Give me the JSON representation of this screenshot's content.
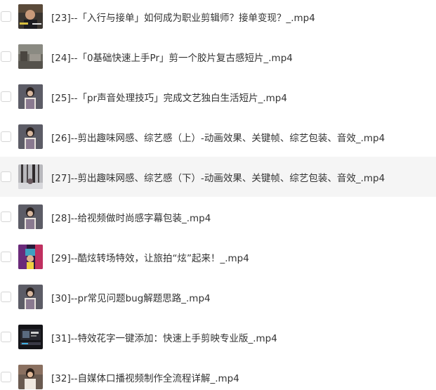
{
  "files": [
    {
      "name": "[23]--「入行与接单」如何成为职业剪辑师？接单变现？_.mp4",
      "thumbnail": "portrait-man-dark"
    },
    {
      "name": "[24]--「0基础快速上手Pr」剪一个胶片复古感短片_.mp4",
      "thumbnail": "street-scene"
    },
    {
      "name": "[25]--「pr声音处理技巧」完成文艺独白生活短片_.mp4",
      "thumbnail": "portrait-woman"
    },
    {
      "name": "[26]--剪出趣味网感、综艺感（上）-动画效果、关键帧、综艺包装、音效_.mp4",
      "thumbnail": "portrait-woman"
    },
    {
      "name": "[27]--剪出趣味网感、综艺感（下）-动画效果、关键帧、综艺包装、音效_.mp4",
      "thumbnail": "winter-trees"
    },
    {
      "name": "[28]--给视频做时尚感字幕包装_.mp4",
      "thumbnail": "portrait-woman"
    },
    {
      "name": "[29]--酷炫转场特效，让旅拍“炫”起来！_.mp4",
      "thumbnail": "colorful-night"
    },
    {
      "name": "[30]--pr常见问题bug解题思路_.mp4",
      "thumbnail": "portrait-woman"
    },
    {
      "name": "[31]--特效花字一键添加：快速上手剪映专业版_.mp4",
      "thumbnail": "dark-screen"
    },
    {
      "name": "[32]--自媒体口播视频制作全流程详解_.mp4",
      "thumbnail": "portrait-woman-warm"
    }
  ],
  "hovered_index": 4
}
